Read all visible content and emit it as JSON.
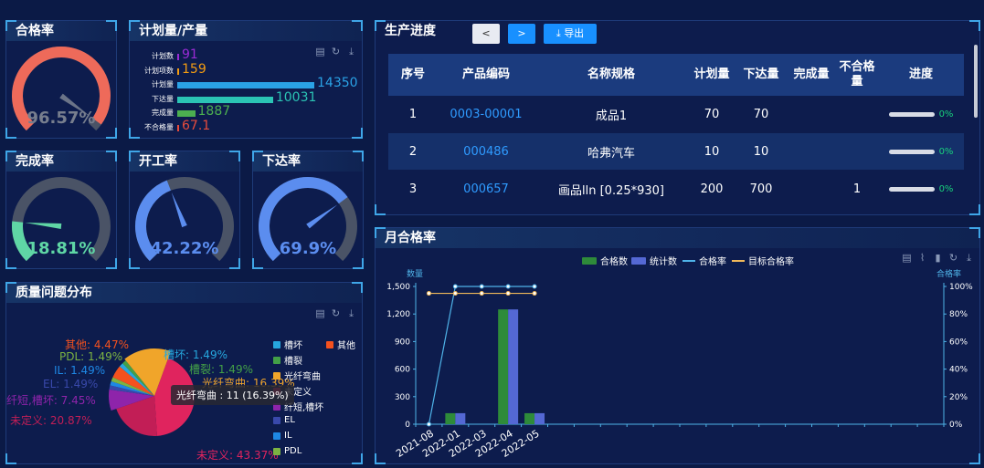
{
  "header": {
    "partial_text": ""
  },
  "panels": {
    "qualified": {
      "title": "合格率",
      "value": "96.57%",
      "fraction": 0.9657,
      "color": "#ee6a5a"
    },
    "plan": {
      "title": "计划量/产量",
      "rows": [
        {
          "label": "计划数",
          "value": "91",
          "color": "#9b2bd6",
          "fraction": 0.0
        },
        {
          "label": "计划项数",
          "value": "159",
          "color": "#f39c12",
          "fraction": 0.0
        },
        {
          "label": "计划量",
          "value": "14350",
          "color": "#2aa2e6",
          "fraction": 1.0
        },
        {
          "label": "下达量",
          "value": "10031",
          "color": "#2bc4b5",
          "fraction": 0.699
        },
        {
          "label": "完成量",
          "value": "1887",
          "color": "#4caf50",
          "fraction": 0.13
        },
        {
          "label": "不合格量",
          "value": "67.1",
          "color": "#e74c3c",
          "fraction": 0.0
        }
      ]
    },
    "completion": {
      "title": "完成率",
      "value": "18.81%",
      "fraction": 0.1881,
      "color": "#5fd6a5"
    },
    "start": {
      "title": "开工率",
      "value": "42.22%",
      "fraction": 0.4222,
      "color": "#5b8def"
    },
    "issue": {
      "title": "下达率",
      "value": "69.9%",
      "fraction": 0.699,
      "color": "#5b8def"
    },
    "quality": {
      "title": "质量问题分布",
      "tooltip": "光纤弯曲 : 11 (16.39%)",
      "slices": [
        {
          "name": "未定义",
          "pct": 43.37,
          "color": "#e0245e",
          "label": "未定义:  43.37%"
        },
        {
          "name": "未定义",
          "pct": 20.87,
          "color": "#c21e56",
          "label": "未定义:  20.87%"
        },
        {
          "name": "纤短,槽坏",
          "pct": 7.45,
          "color": "#8e24aa",
          "label": "纤短,槽坏:  7.45%"
        },
        {
          "name": "EL",
          "pct": 1.49,
          "color": "#3949ab",
          "label": "EL:  1.49%"
        },
        {
          "name": "IL",
          "pct": 1.49,
          "color": "#1e88e5",
          "label": "IL:  1.49%"
        },
        {
          "name": "PDL",
          "pct": 1.49,
          "color": "#7cb342",
          "label": "PDL:  1.49%"
        },
        {
          "name": "其他",
          "pct": 4.47,
          "color": "#f4511e",
          "label": "其他:  4.47%"
        },
        {
          "name": "槽坏",
          "pct": 1.49,
          "color": "#26a7de",
          "label": "槽坏:  1.49%"
        },
        {
          "name": "槽裂",
          "pct": 1.49,
          "color": "#43a047",
          "label": "槽裂:  1.49%"
        },
        {
          "name": "光纤弯曲",
          "pct": 16.39,
          "color": "#f0a52a",
          "label": "光纤弯曲:  16.39%"
        }
      ],
      "legend": [
        {
          "name": "槽坏",
          "color": "#26a7de"
        },
        {
          "name": "其他",
          "color": "#f4511e"
        },
        {
          "name": "槽裂",
          "color": "#43a047"
        },
        {
          "name": "光纤弯曲",
          "color": "#f0a52a"
        },
        {
          "name": "未定义",
          "color": "#e0245e"
        },
        {
          "name": "纤短,槽坏",
          "color": "#8e24aa"
        },
        {
          "name": "EL",
          "color": "#3949ab"
        },
        {
          "name": "IL",
          "color": "#1e88e5"
        },
        {
          "name": "PDL",
          "color": "#7cb342"
        }
      ]
    },
    "progress": {
      "title": "生产进度",
      "prev_label": "<",
      "next_label": ">",
      "export_label": "导出",
      "columns": [
        "序号",
        "产品编码",
        "名称规格",
        "计划量",
        "下达量",
        "完成量",
        "不合格量",
        "进度"
      ],
      "rows": [
        {
          "no": "1",
          "code": "0003-00001",
          "name": "成品1",
          "plan": "70",
          "issued": "70",
          "done": "",
          "bad": "",
          "progress": "0%"
        },
        {
          "no": "2",
          "code": "000486",
          "name": "哈弗汽车",
          "plan": "10",
          "issued": "10",
          "done": "",
          "bad": "",
          "progress": "0%"
        },
        {
          "no": "3",
          "code": "000657",
          "name": "画品lln [0.25*930]",
          "plan": "200",
          "issued": "700",
          "done": "",
          "bad": "1",
          "progress": "0%"
        }
      ]
    },
    "monthly": {
      "title": "月合格率",
      "legend": [
        "合格数",
        "统计数",
        "合格率",
        "目标合格率"
      ],
      "left_axis_name": "数量",
      "right_axis_name": "合格率"
    }
  },
  "chart_data": {
    "type": "bar",
    "title": "月合格率",
    "categories": [
      "2021-08",
      "2022-01",
      "2022-03",
      "2022-04",
      "2022-05"
    ],
    "ylabel": "数量",
    "y2label": "合格率",
    "ylim": [
      0,
      1500
    ],
    "y2lim": [
      0,
      100
    ],
    "yticks": [
      "0",
      "300",
      "600",
      "900",
      "1,200",
      "1,500"
    ],
    "y2ticks": [
      "0%",
      "20%",
      "40%",
      "60%",
      "80%",
      "100%"
    ],
    "series": [
      {
        "name": "合格数",
        "type": "bar",
        "color": "#2e8b3a",
        "values": [
          0,
          120,
          0,
          1250,
          120
        ]
      },
      {
        "name": "统计数",
        "type": "bar",
        "color": "#5468d4",
        "values": [
          0,
          120,
          0,
          1250,
          120
        ]
      },
      {
        "name": "合格率",
        "type": "line",
        "color": "#4fb3e8",
        "values": [
          0,
          100,
          100,
          100,
          100
        ]
      },
      {
        "name": "目标合格率",
        "type": "line",
        "color": "#f0b85a",
        "values": [
          95,
          95,
          95,
          95,
          95
        ]
      }
    ]
  }
}
